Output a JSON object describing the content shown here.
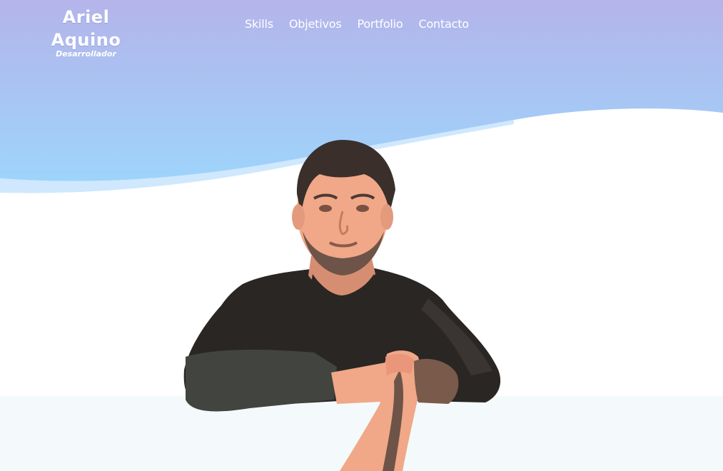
{
  "brand": {
    "name": "Ariel Aquino",
    "role": "Desarrollador"
  },
  "nav": {
    "items": [
      "Skills",
      "Objetivos",
      "Portfolio",
      "Contacto"
    ]
  },
  "colors": {
    "hero_top": "#b4b4ea",
    "hero_bottom": "#9ed4fb",
    "wave_light": "#cfe8fd",
    "page_bg": "#ffffff",
    "footer_band": "#f4fafb",
    "shirt": "#2a2624",
    "skin": "#f0a888",
    "hair": "#3a2f2b"
  },
  "hero": {
    "portrait_icon": "profile-portrait-illustration"
  }
}
